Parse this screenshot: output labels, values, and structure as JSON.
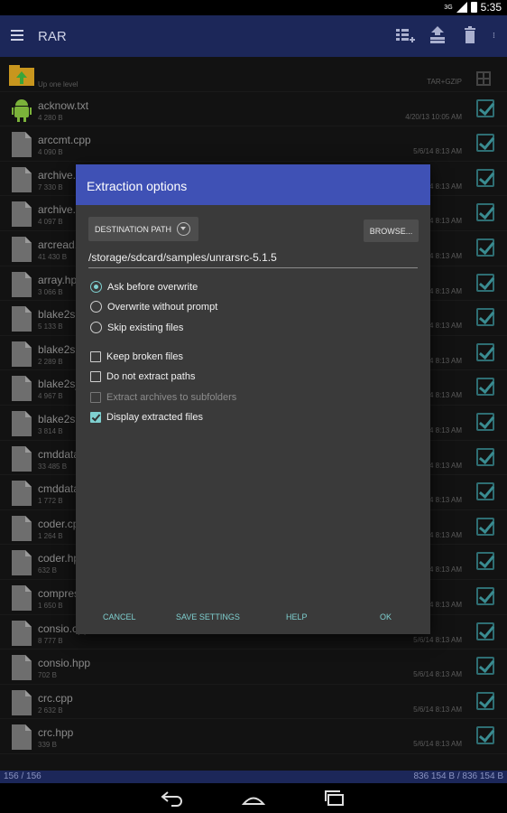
{
  "status": {
    "time": "5:35",
    "network": "3G"
  },
  "appbar": {
    "title": "RAR"
  },
  "up_row": {
    "label": "Up one level",
    "archive_type": "TAR+GZIP"
  },
  "files": [
    {
      "name": "acknow.txt",
      "size": "4 280 B",
      "date": "4/20/13 10:05 AM",
      "icon": "android-icon"
    },
    {
      "name": "arccmt.cpp",
      "size": "4 090 B",
      "date": "5/6/14 8:13 AM"
    },
    {
      "name": "archive.cpp",
      "size": "7 330 B",
      "date": "5/6/14 8:13 AM"
    },
    {
      "name": "archive.hpp",
      "size": "4 097 B",
      "date": "5/6/14 8:13 AM"
    },
    {
      "name": "arcread.cpp",
      "size": "41 430 B",
      "date": "5/6/14 8:13 AM"
    },
    {
      "name": "array.hpp",
      "size": "3 066 B",
      "date": "5/6/14 8:13 AM"
    },
    {
      "name": "blake2s.cpp",
      "size": "5 133 B",
      "date": "5/6/14 8:13 AM"
    },
    {
      "name": "blake2s.hpp",
      "size": "2 289 B",
      "date": "5/6/14 8:13 AM"
    },
    {
      "name": "blake2s_sse.cpp",
      "size": "4 967 B",
      "date": "5/6/14 8:13 AM"
    },
    {
      "name": "blake2sp.cpp",
      "size": "3 814 B",
      "date": "5/6/14 8:13 AM"
    },
    {
      "name": "cmddata.cpp",
      "size": "33 485 B",
      "date": "5/6/14 8:13 AM"
    },
    {
      "name": "cmddata.hpp",
      "size": "1 772 B",
      "date": "5/6/14 8:13 AM"
    },
    {
      "name": "coder.cpp",
      "size": "1 264 B",
      "date": "5/6/14 8:13 AM"
    },
    {
      "name": "coder.hpp",
      "size": "632 B",
      "date": "5/6/14 8:13 AM"
    },
    {
      "name": "compress.hpp",
      "size": "1 650 B",
      "date": "5/6/14 8:13 AM"
    },
    {
      "name": "consio.cpp",
      "size": "8 777 B",
      "date": "5/6/14 8:13 AM"
    },
    {
      "name": "consio.hpp",
      "size": "702 B",
      "date": "5/6/14 8:13 AM"
    },
    {
      "name": "crc.cpp",
      "size": "2 632 B",
      "date": "5/6/14 8:13 AM"
    },
    {
      "name": "crc.hpp",
      "size": "339 B",
      "date": "5/6/14 8:13 AM"
    }
  ],
  "footer": {
    "count": "156 / 156",
    "total": "836 154 B / 836 154 B"
  },
  "dialog": {
    "title": "Extraction options",
    "dest_label": "DESTINATION PATH",
    "browse_label": "BROWSE...",
    "path": "/storage/sdcard/samples/unrarsrc-5.1.5",
    "overwrite": [
      "Ask before overwrite",
      "Overwrite without prompt",
      "Skip existing files"
    ],
    "options": [
      "Keep broken files",
      "Do not extract paths",
      "Extract archives to subfolders",
      "Display extracted files"
    ],
    "buttons": {
      "cancel": "CANCEL",
      "save": "SAVE SETTINGS",
      "help": "HELP",
      "ok": "OK"
    }
  },
  "colors": {
    "appbar": "#1c2759",
    "dialog_header": "#3f51b5",
    "accent": "#7fd0d0"
  }
}
